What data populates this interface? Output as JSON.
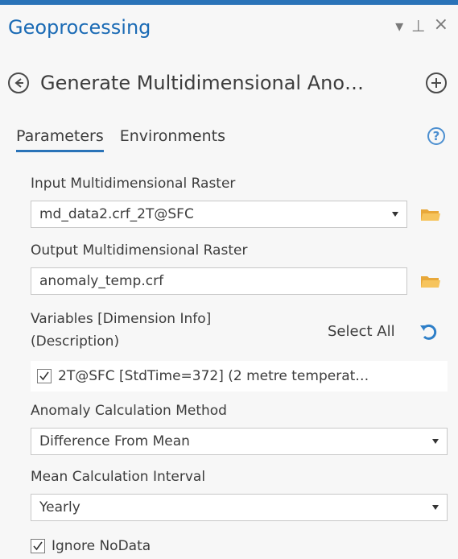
{
  "pane": {
    "title": "Geoprocessing",
    "controls": {
      "menu": "▾",
      "pin": "⊥",
      "close": "×"
    }
  },
  "tool": {
    "title": "Generate Multidimensional Ano…"
  },
  "tabs": [
    {
      "label": "Parameters",
      "active": true
    },
    {
      "label": "Environments",
      "active": false
    }
  ],
  "help_glyph": "?",
  "params": {
    "input_raster": {
      "label": "Input Multidimensional Raster",
      "value": "md_data2.crf_2T@SFC"
    },
    "output_raster": {
      "label": "Output Multidimensional Raster",
      "value": "anomaly_temp.crf"
    },
    "variables": {
      "label_line1": "Variables [Dimension Info]",
      "label_line2": "(Description)",
      "select_all": "Select All",
      "items": [
        {
          "text": "2T@SFC [StdTime=372] (2 metre temperat…",
          "checked": true
        }
      ]
    },
    "method": {
      "label": "Anomaly Calculation Method",
      "value": "Difference From Mean"
    },
    "interval": {
      "label": "Mean Calculation Interval",
      "value": "Yearly"
    },
    "ignore_nodata": {
      "label": "Ignore NoData",
      "checked": true
    }
  },
  "colors": {
    "accent": "#2a73b8",
    "folder": "#f2b84b"
  }
}
